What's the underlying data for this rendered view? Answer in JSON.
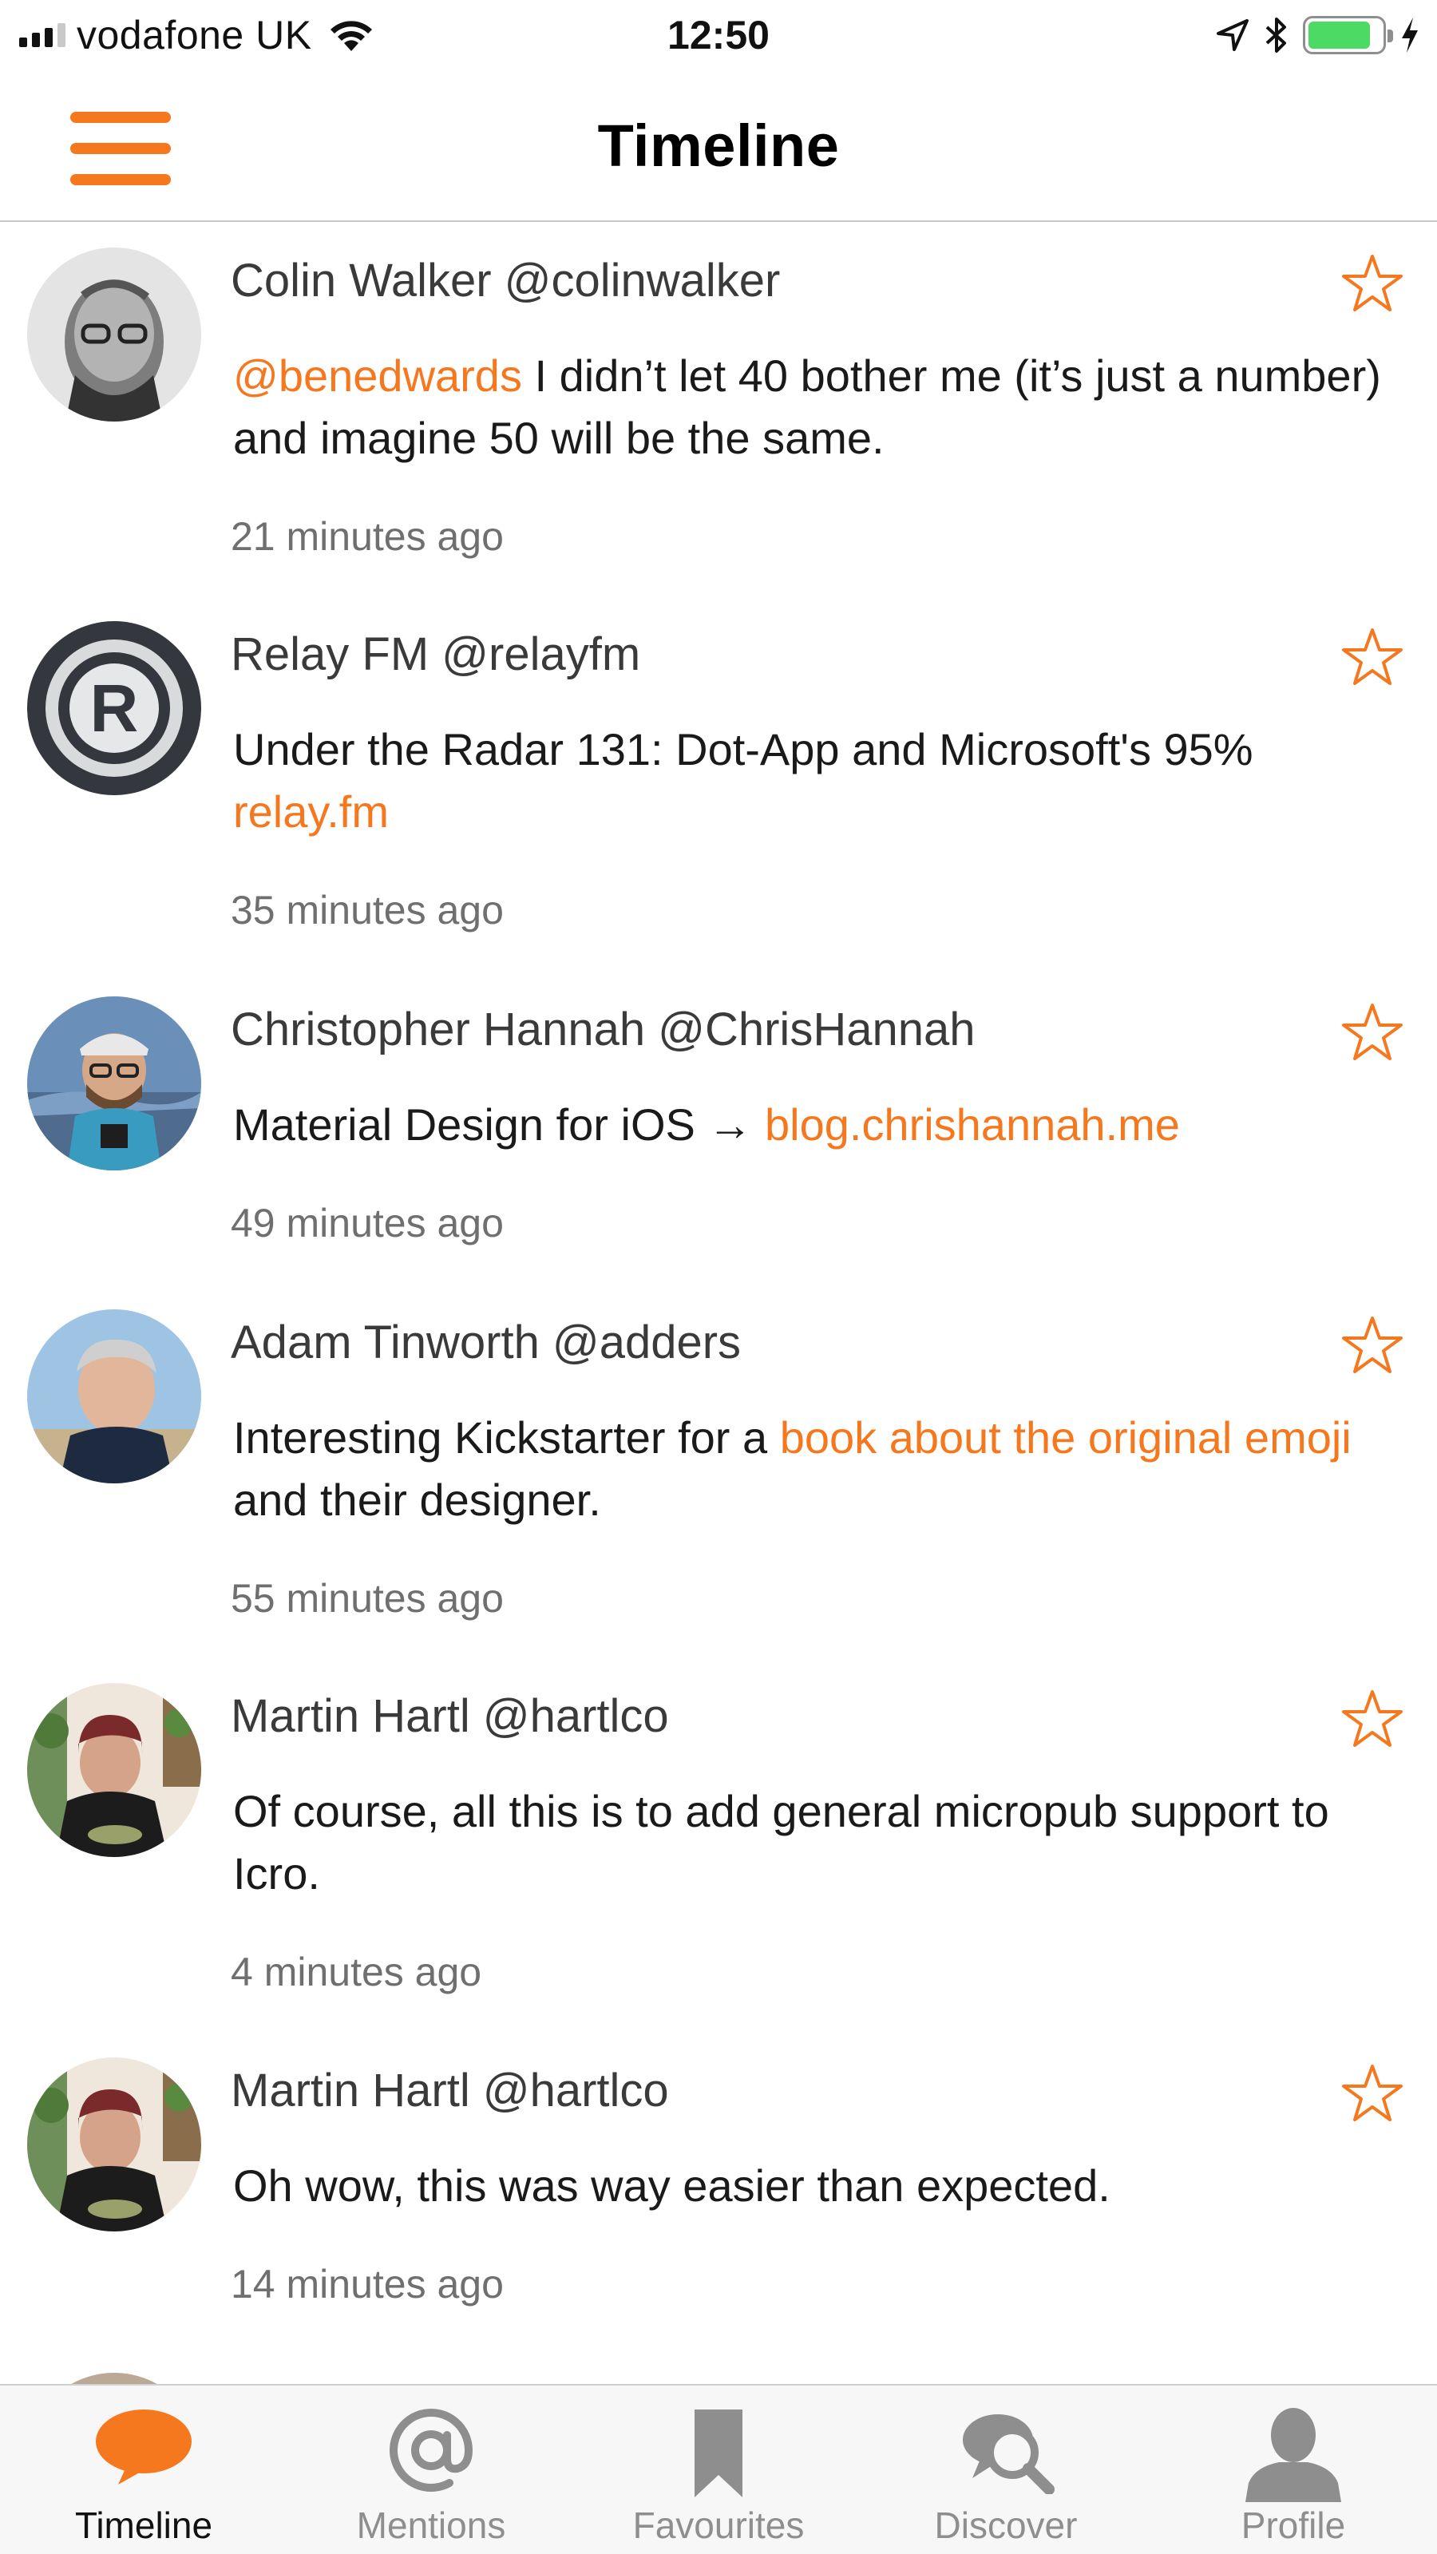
{
  "status_bar": {
    "carrier": "vodafone UK",
    "time": "12:50",
    "battery_level": 0.85
  },
  "nav": {
    "title": "Timeline"
  },
  "colors": {
    "accent": "#f5781e",
    "battery": "#4cd964"
  },
  "posts": [
    {
      "name": "Colin Walker",
      "handle": "@colinwalker",
      "content": [
        {
          "text": "@benedwards",
          "link": true
        },
        {
          "text": " I didn’t let 40 bother me (it’s just a number) and imagine 50 will be the same.",
          "link": false
        }
      ],
      "time": "21 minutes ago",
      "avatar": "avatar-colin"
    },
    {
      "name": "Relay FM",
      "handle": "@relayfm",
      "content": [
        {
          "text": "Under the Radar 131: Dot-App and Microsoft's 95% ",
          "link": false
        },
        {
          "text": "relay.fm",
          "link": true
        }
      ],
      "time": "35 minutes ago",
      "avatar": "avatar-relayfm"
    },
    {
      "name": "Christopher Hannah",
      "handle": "@ChrisHannah",
      "content": [
        {
          "text": "Material Design for iOS → ",
          "link": false
        },
        {
          "text": "blog.chrishannah.me",
          "link": true
        }
      ],
      "time": "49 minutes ago",
      "avatar": "avatar-chris"
    },
    {
      "name": "Adam Tinworth",
      "handle": "@adders",
      "content": [
        {
          "text": "Interesting Kickstarter for a ",
          "link": false
        },
        {
          "text": "book about the original emoji",
          "link": true
        },
        {
          "text": " and their designer.",
          "link": false
        }
      ],
      "time": "55 minutes ago",
      "avatar": "avatar-adam"
    },
    {
      "name": "Martin Hartl",
      "handle": "@hartlco",
      "content": [
        {
          "text": "Of course, all this is to add general micropub support to Icro.",
          "link": false
        }
      ],
      "time": "4 minutes ago",
      "avatar": "avatar-martin"
    },
    {
      "name": "Martin Hartl",
      "handle": "@hartlco",
      "content": [
        {
          "text": "Oh wow, this was way easier than expected.",
          "link": false
        }
      ],
      "time": "14 minutes ago",
      "avatar": "avatar-martin"
    }
  ],
  "tabs": [
    {
      "label": "Timeline",
      "icon": "speech-bubble-icon",
      "active": true
    },
    {
      "label": "Mentions",
      "icon": "at-sign-icon",
      "active": false
    },
    {
      "label": "Favourites",
      "icon": "bookmark-icon",
      "active": false
    },
    {
      "label": "Discover",
      "icon": "discover-bubbles-icon",
      "active": false
    },
    {
      "label": "Profile",
      "icon": "person-icon",
      "active": false
    }
  ]
}
